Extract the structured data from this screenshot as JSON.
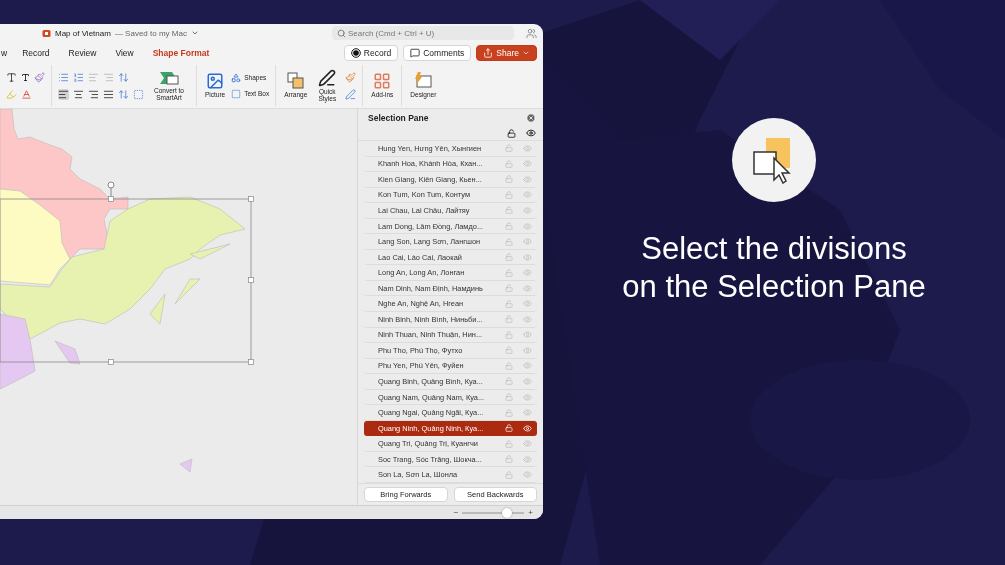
{
  "window": {
    "title": "Map of Vietnam",
    "status": "— Saved to my Mac"
  },
  "search": {
    "placeholder": "Search (Cmd + Ctrl + U)"
  },
  "tabs": [
    {
      "label": "w",
      "selected": false
    },
    {
      "label": "Record",
      "selected": false
    },
    {
      "label": "Review",
      "selected": false
    },
    {
      "label": "View",
      "selected": false
    },
    {
      "label": "Shape Format",
      "selected": true
    }
  ],
  "actions": [
    {
      "label": "Record",
      "kind": "record"
    },
    {
      "label": "Comments",
      "kind": "comments"
    },
    {
      "label": "Share",
      "kind": "share"
    }
  ],
  "ribbon": {
    "convert": "Convert to SmartArt",
    "picture": "Picture",
    "shapes": "Shapes",
    "text_box": "Text Box",
    "arrange": "Arrange",
    "quick_styles": "Quick Styles",
    "add_ins": "Add-ins",
    "designer": "Designer"
  },
  "selection_pane": {
    "title": "Selection Pane",
    "items": [
      {
        "name": "Hung Yen, Hưng Yên, Хынгиен",
        "selected": false
      },
      {
        "name": "Khanh Hoa, Khánh Hòa, Кхан...",
        "selected": false
      },
      {
        "name": "Kien Giang, Kiên Giang, Кьен...",
        "selected": false
      },
      {
        "name": "Kon Tum, Kon Tum, Контум",
        "selected": false
      },
      {
        "name": "Lai Chau, Lai Châu, Лайтяу",
        "selected": false
      },
      {
        "name": "Lam Dong, Lâm Đồng, Ламдо...",
        "selected": false
      },
      {
        "name": "Lang Son, Lạng Sơn, Лангшон",
        "selected": false
      },
      {
        "name": "Lao Cai, Lào Cai, Лаокай",
        "selected": false
      },
      {
        "name": "Long An, Long An, Лонган",
        "selected": false
      },
      {
        "name": "Nam Dinh, Nam Định, Намдинь",
        "selected": false
      },
      {
        "name": "Nghe An, Nghệ An, Нгеан",
        "selected": false
      },
      {
        "name": "Ninh Binh, Ninh Bình, Ниньби...",
        "selected": false
      },
      {
        "name": "Ninh Thuan, Ninh Thuận, Нин...",
        "selected": false
      },
      {
        "name": "Phu Tho, Phú Thọ, Футхо",
        "selected": false
      },
      {
        "name": "Phu Yen, Phú Yên, Фуйен",
        "selected": false
      },
      {
        "name": "Quang Binh, Quảng Bình, Куа...",
        "selected": false
      },
      {
        "name": "Quang Nam, Quảng Nam, Куа...",
        "selected": false
      },
      {
        "name": "Quang Ngai, Quảng Ngãi, Куа...",
        "selected": false
      },
      {
        "name": "Quang Ninh, Quảng Ninh, Куа...",
        "selected": true
      },
      {
        "name": "Quang Tri, Quảng Trị, Куангчи",
        "selected": false
      },
      {
        "name": "Soc Trang, Sóc Trăng, Шокча...",
        "selected": false
      },
      {
        "name": "Son La, Sơn La, Шонла",
        "selected": false
      }
    ],
    "buttons": [
      "Bring Forwards",
      "Send Backwards"
    ]
  },
  "zoom": {
    "level": 0.72,
    "minus": "−",
    "plus": "+"
  },
  "caption": "Select the divisions\non the Selection Pane"
}
